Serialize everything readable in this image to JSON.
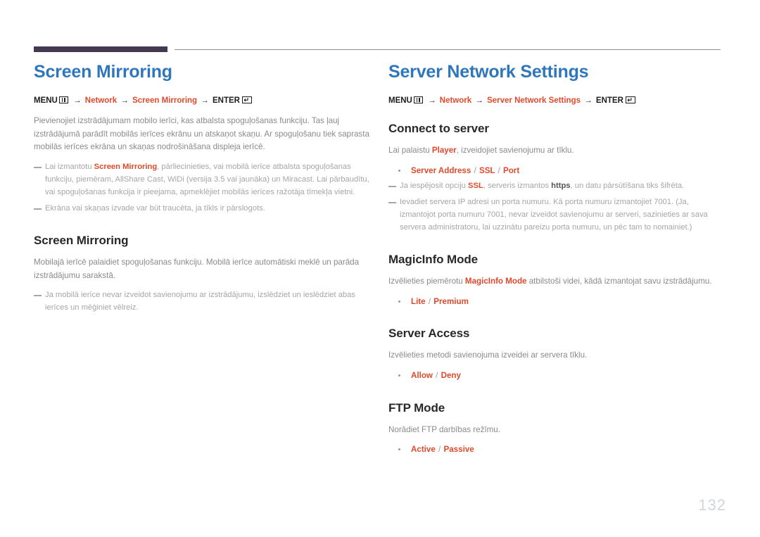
{
  "page": {
    "number": "132",
    "accent_color": "#e0492a",
    "title_color": "#2f77bd",
    "rule_color": "#433a52"
  },
  "left_column": {
    "title": "Screen Mirroring",
    "breadcrumb": {
      "menu_label": "MENU",
      "menu_icon": "menu-grid-icon",
      "arrow": "→",
      "crumb1": "Network",
      "crumb2": "Screen Mirroring",
      "enter_label": "ENTER",
      "enter_icon": "enter-key-icon"
    },
    "intro": {
      "text": "Pievienojiet izstrādājumam mobilo ierīci, kas atbalsta spoguļošanas funkciju. Tas ļauj izstrādājumā parādīt mobilās ierīces ekrānu un atskaņot skaņu. Ar spoguļošanu tiek saprasta mobilās ierīces ekrāna un skaņas nodrošināšana displeja ierīcē."
    },
    "notes": [
      {
        "prefix": "Lai izmantotu ",
        "accent": "Screen Mirroring",
        "suffix": ", pārliecinieties, vai mobilā ierīce atbalsta spoguļošanas funkciju, piemēram, AllShare Cast, WiDi (versija 3.5 vai jaunāka) un Miracast. Lai pārbaudītu, vai spoguļošanas funkcija ir pieejama, apmeklējiet mobilās ierīces ražotāja tīmekļa vietni."
      },
      {
        "prefix": "Ekrāna vai skaņas izvade var būt traucēta, ja tīkls ir pārslogots.",
        "accent": "",
        "suffix": ""
      }
    ],
    "section": {
      "title": "Screen Mirroring",
      "body": "Mobilajā ierīcē palaidiet spoguļošanas funkciju. Mobilā ierīce automātiski meklē un parāda izstrādājumu sarakstā.",
      "note": "Ja mobilā ierīce nevar izveidot savienojumu ar izstrādājumu, izslēdziet un ieslēdziet abas ierīces un mēģiniet vēlreiz."
    }
  },
  "right_column": {
    "title": "Server Network Settings",
    "breadcrumb": {
      "menu_label": "MENU",
      "menu_icon": "menu-grid-icon",
      "arrow": "→",
      "crumb1": "Network",
      "crumb2": "Server Network Settings",
      "enter_label": "ENTER",
      "enter_icon": "enter-key-icon"
    },
    "sections": [
      {
        "title": "Connect to server",
        "body_prefix": "Lai palaistu ",
        "body_accent": "Player",
        "body_suffix": ", izveidojiet savienojumu ar tīklu.",
        "option": "Server Address / SSL / Port",
        "notes": [
          {
            "p1": "Ja iespējosit opciju ",
            "a1": "SSL",
            "p2": ", serveris izmantos ",
            "s1": "https",
            "p3": ", un datu pārsūtīšana tiks šifrēta."
          },
          {
            "p1": "Ievadiet servera IP adresi un porta numuru. Kā porta numuru izmantojiet 7001. (Ja, izmantojot porta numuru 7001, nevar izveidot savienojumu ar serveri, sazinieties ar sava servera administratoru, lai uzzinātu pareizu porta numuru, un pēc tam to nomainiet.)",
            "a1": "",
            "p2": "",
            "s1": "",
            "p3": ""
          }
        ]
      },
      {
        "title": "MagicInfo Mode",
        "body_prefix": "Izvēlieties piemērotu ",
        "body_accent": "MagicInfo Mode",
        "body_suffix": " atbilstoši videi, kādā izmantojat savu izstrādājumu.",
        "option": "Lite / Premium",
        "notes": []
      },
      {
        "title": "Server Access",
        "body_prefix": "Izvēlieties metodi savienojuma izveidei ar servera tīklu.",
        "body_accent": "",
        "body_suffix": "",
        "option": "Allow / Deny",
        "notes": []
      },
      {
        "title": "FTP Mode",
        "body_prefix": "Norādiet FTP darbības režīmu.",
        "body_accent": "",
        "body_suffix": "",
        "option": "Active / Passive",
        "notes": []
      }
    ]
  }
}
